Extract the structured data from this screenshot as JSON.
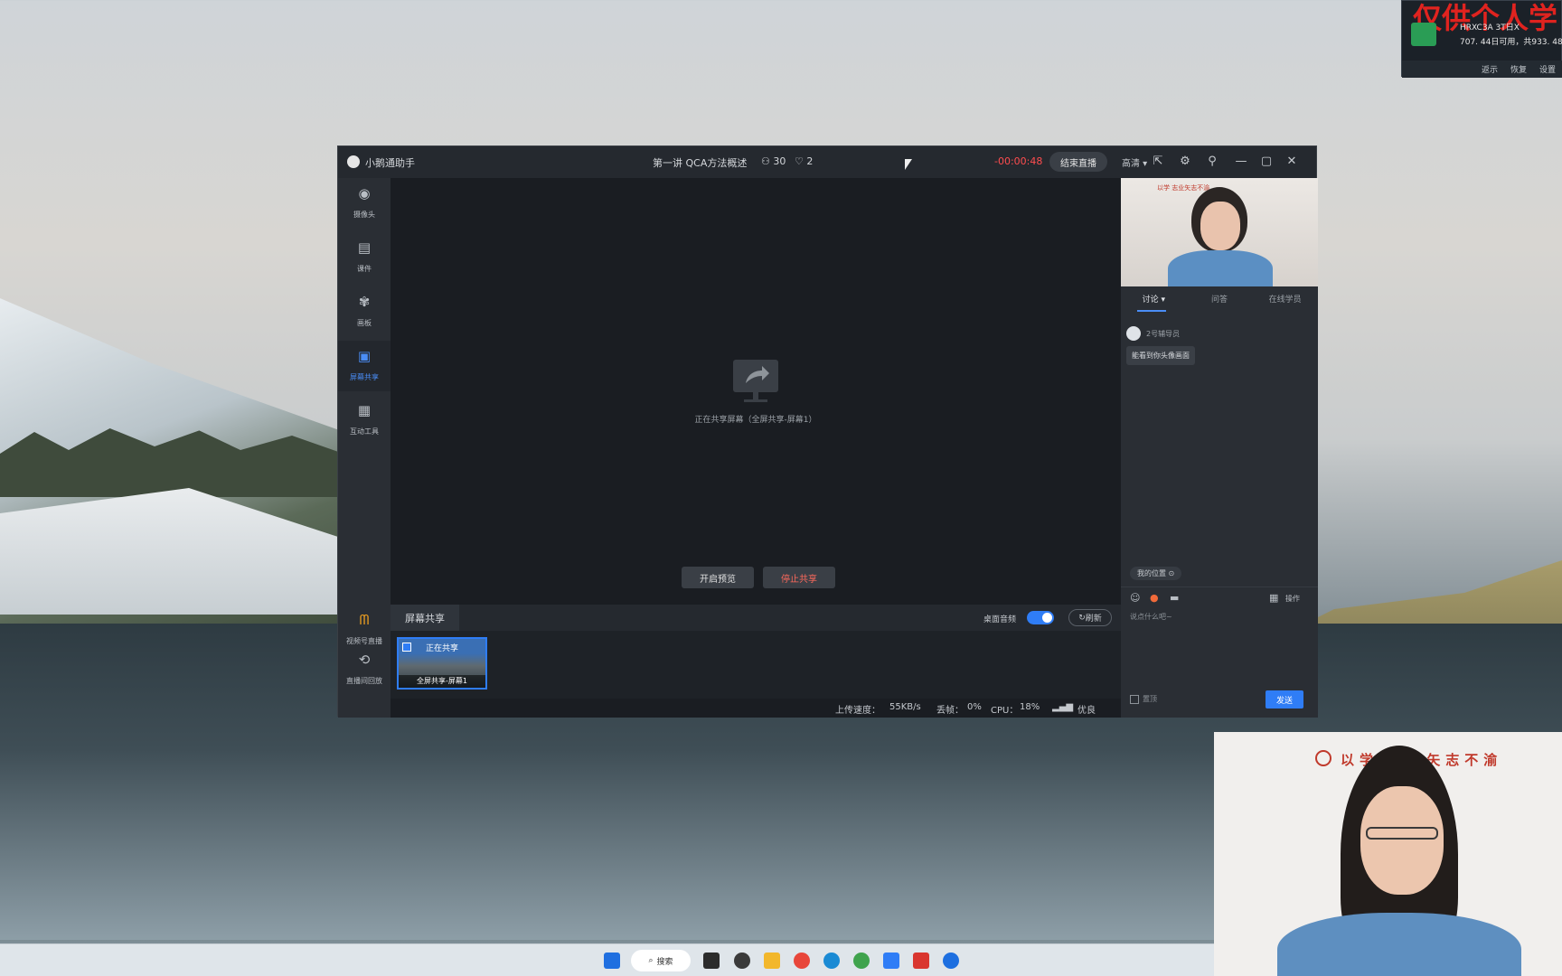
{
  "monitor": {
    "watermark": "仅供个人学",
    "line1": "HRXC3A 3T日X",
    "line2": "707. 44日可用，共933. 48日",
    "actions": [
      "返示",
      "恢复",
      "设置"
    ]
  },
  "window": {
    "app_name": "小鹅通助手",
    "course_title": "第一讲 QCA方法概述",
    "viewer_count": "30",
    "like_count": "2",
    "timer": "-00:00:48",
    "end_live_label": "结束直播",
    "quality_label": "高清"
  },
  "nav": {
    "items": [
      {
        "label": "摄像头",
        "icon": "camera-icon"
      },
      {
        "label": "课件",
        "icon": "file-icon"
      },
      {
        "label": "画板",
        "icon": "palette-icon"
      },
      {
        "label": "屏幕共享",
        "icon": "screen-share-icon"
      },
      {
        "label": "互动工具",
        "icon": "toolbox-icon"
      }
    ],
    "bottom_items": [
      {
        "label": "视频号直播",
        "icon": "video-channel-icon"
      },
      {
        "label": "直播间回放",
        "icon": "replay-icon"
      }
    ]
  },
  "stage": {
    "share_status": "正在共享屏幕（全屏共享-屏幕1）",
    "preview_btn": "开启预览",
    "stop_btn": "停止共享"
  },
  "sharebar": {
    "tab": "屏幕共享",
    "audio_label": "桌面音频",
    "refresh_label": "刷新",
    "thumb_status": "正在共享",
    "thumb_caption": "全屏共享-屏幕1"
  },
  "status": {
    "upload_label": "上传速度：",
    "upload_value": "55KB/s",
    "loss_label": "丢帧：",
    "loss_value": "0%",
    "cpu_label": "CPU：",
    "cpu_value": "18%",
    "net_label": "优良"
  },
  "rpanel": {
    "tabs": [
      "讨论",
      "问答",
      "在线学员"
    ],
    "msg_name": "2号辅导员",
    "msg_text": "能看到你头像画面",
    "my_rank": "我的位置",
    "tools_label": "操作",
    "input_placeholder": "说点什么吧~",
    "checkbox_label": "置顶",
    "send_label": "发送"
  },
  "teacher_overlay": {
    "motto": "以学  志业矢志不渝"
  },
  "taskbar": {
    "search_label": "搜索"
  },
  "colors": {
    "accent": "#2f7df6",
    "timer": "#ff4d4f",
    "stop": "#ff6a5c"
  }
}
